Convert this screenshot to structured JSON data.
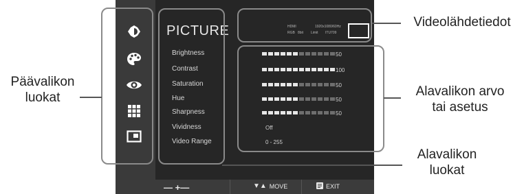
{
  "menu": {
    "title": "PICTURE",
    "categories": [
      {
        "icon": "brightness-icon"
      },
      {
        "icon": "palette-icon"
      },
      {
        "icon": "eye-icon"
      },
      {
        "icon": "grid-icon"
      },
      {
        "icon": "picture-in-picture-icon"
      }
    ],
    "items": [
      {
        "label": "Brightness",
        "value": "50",
        "level": 0.5
      },
      {
        "label": "Contrast",
        "value": "100",
        "level": 1.0
      },
      {
        "label": "Saturation",
        "value": "50",
        "level": 0.5
      },
      {
        "label": "Hue",
        "value": "50",
        "level": 0.5
      },
      {
        "label": "Sharpness",
        "value": "50",
        "level": 0.5
      },
      {
        "label": "Vividness",
        "value": "Off"
      },
      {
        "label": "Video Range",
        "value": "0 - 255"
      }
    ]
  },
  "source_info": {
    "interface": "HDMI",
    "resolution": "1920x1080/60Hz",
    "color_format": "RGB",
    "bit_depth": "8bit",
    "range": "Limit",
    "standard": "ITU709"
  },
  "bottom_bar": {
    "adjust_label": "— +—",
    "move_label": "MOVE",
    "exit_label": "EXIT"
  },
  "annotations": {
    "main_categories_line1": "Päävalikon",
    "main_categories_line2": "luokat",
    "source_info": "Videolähdetiedot",
    "submenu_value_line1": "Alavalikon arvo",
    "submenu_value_line2": "tai asetus",
    "submenu_categories_line1": "Alavalikon",
    "submenu_categories_line2": "luokat"
  }
}
